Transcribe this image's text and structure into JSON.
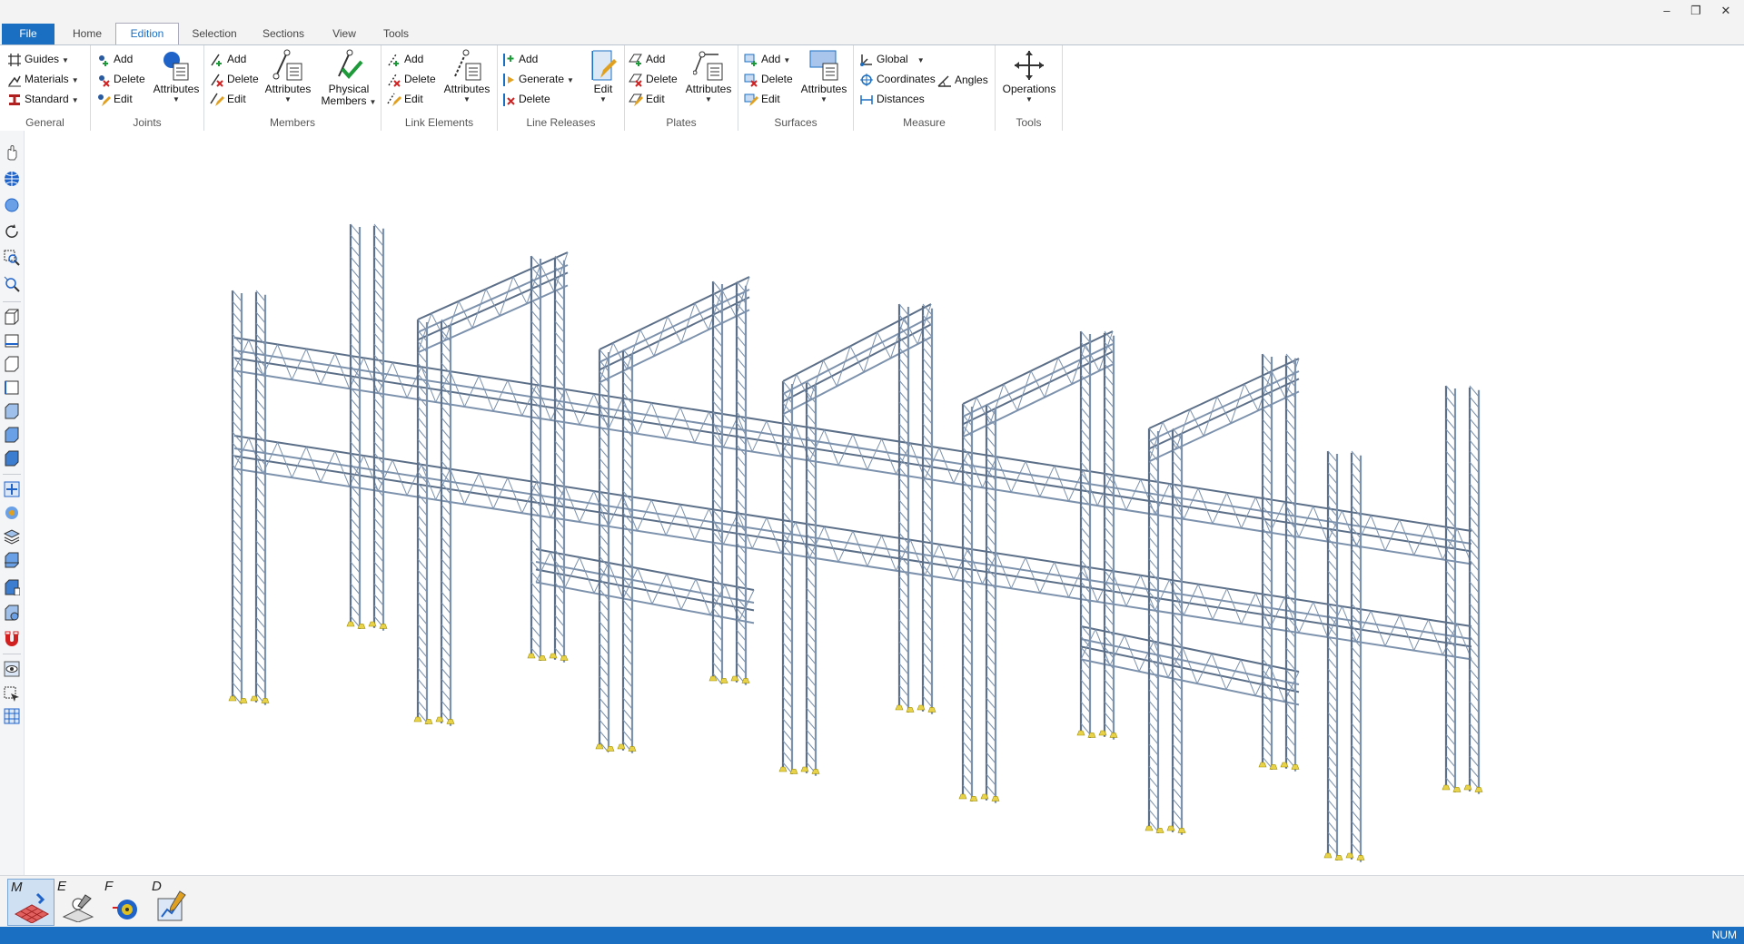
{
  "tabs": [
    {
      "label": "File"
    },
    {
      "label": "Home"
    },
    {
      "label": "Edition"
    },
    {
      "label": "Selection"
    },
    {
      "label": "Sections"
    },
    {
      "label": "View"
    },
    {
      "label": "Tools"
    }
  ],
  "ribbon": {
    "general": {
      "label": "General",
      "guides": "Guides",
      "materials": "Materials",
      "standard": "Standard"
    },
    "joints": {
      "label": "Joints",
      "add": "Add",
      "delete": "Delete",
      "edit": "Edit",
      "attributes": "Attributes"
    },
    "members": {
      "label": "Members",
      "add": "Add",
      "delete": "Delete",
      "edit": "Edit",
      "attributes": "Attributes",
      "physical_line1": "Physical",
      "physical_line2": "Members"
    },
    "link_elements": {
      "label": "Link Elements",
      "add": "Add",
      "delete": "Delete",
      "edit": "Edit",
      "attributes": "Attributes"
    },
    "line_releases": {
      "label": "Line Releases",
      "add": "Add",
      "generate": "Generate",
      "delete": "Delete",
      "edit": "Edit"
    },
    "plates": {
      "label": "Plates",
      "add": "Add",
      "delete": "Delete",
      "edit": "Edit",
      "attributes": "Attributes"
    },
    "surfaces": {
      "label": "Surfaces",
      "add": "Add",
      "delete": "Delete",
      "edit": "Edit",
      "attributes": "Attributes"
    },
    "measure": {
      "label": "Measure",
      "global": "Global",
      "coordinates": "Coordinates",
      "distances": "Distances",
      "angles": "Angles"
    },
    "tools": {
      "label": "Tools",
      "operations": "Operations"
    }
  },
  "modes": [
    {
      "letter": "M",
      "icon": "model-mode-icon"
    },
    {
      "letter": "E",
      "icon": "edition-mode-icon"
    },
    {
      "letter": "F",
      "icon": "forces-mode-icon"
    },
    {
      "letter": "D",
      "icon": "design-mode-icon"
    }
  ],
  "status": {
    "num": "NUM"
  },
  "colors": {
    "accent": "#1b6fc2",
    "truss": "#7d92ad",
    "truss_dark": "#5c6f88",
    "support": "#e8d24a"
  }
}
